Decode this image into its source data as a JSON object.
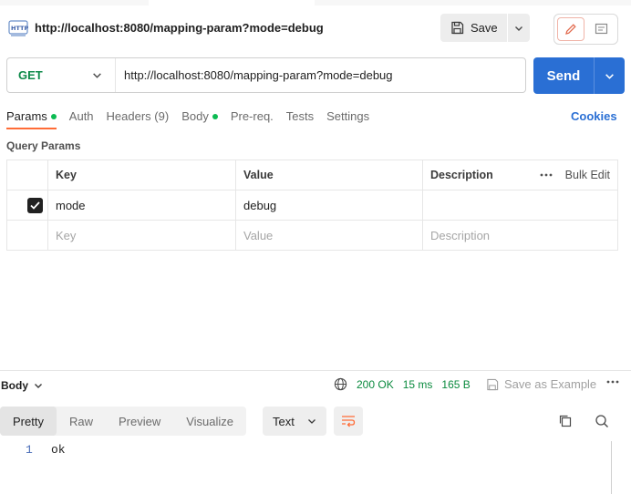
{
  "request": {
    "title": "http://localhost:8080/mapping-param?mode=debug",
    "method": "GET",
    "url": "http://localhost:8080/mapping-param?mode=debug"
  },
  "toolbar": {
    "save_label": "Save",
    "send_label": "Send"
  },
  "tabs": [
    {
      "label": "Params",
      "active": true,
      "dot": true
    },
    {
      "label": "Auth"
    },
    {
      "label": "Headers (9)"
    },
    {
      "label": "Body",
      "dot": true
    },
    {
      "label": "Pre-req."
    },
    {
      "label": "Tests"
    },
    {
      "label": "Settings"
    }
  ],
  "cookies_label": "Cookies",
  "query_params": {
    "title": "Query Params",
    "headers": {
      "key": "Key",
      "value": "Value",
      "description": "Description",
      "bulk_edit": "Bulk Edit"
    },
    "rows": [
      {
        "checked": true,
        "key": "mode",
        "value": "debug",
        "description": ""
      }
    ],
    "placeholders": {
      "key": "Key",
      "value": "Value",
      "description": "Description"
    }
  },
  "response": {
    "body_label": "Body",
    "status": "200 OK",
    "time": "15 ms",
    "size": "165 B",
    "save_example_label": "Save as Example",
    "view_tabs": [
      "Pretty",
      "Raw",
      "Preview",
      "Visualize"
    ],
    "active_view": "Pretty",
    "format": "Text",
    "lines": [
      {
        "no": "1",
        "text": "ok"
      }
    ]
  },
  "colors": {
    "method_get": "#0e8a4a",
    "send": "#2a6fd4",
    "accent": "#ff6c37",
    "status_ok": "#0a8a3e"
  }
}
